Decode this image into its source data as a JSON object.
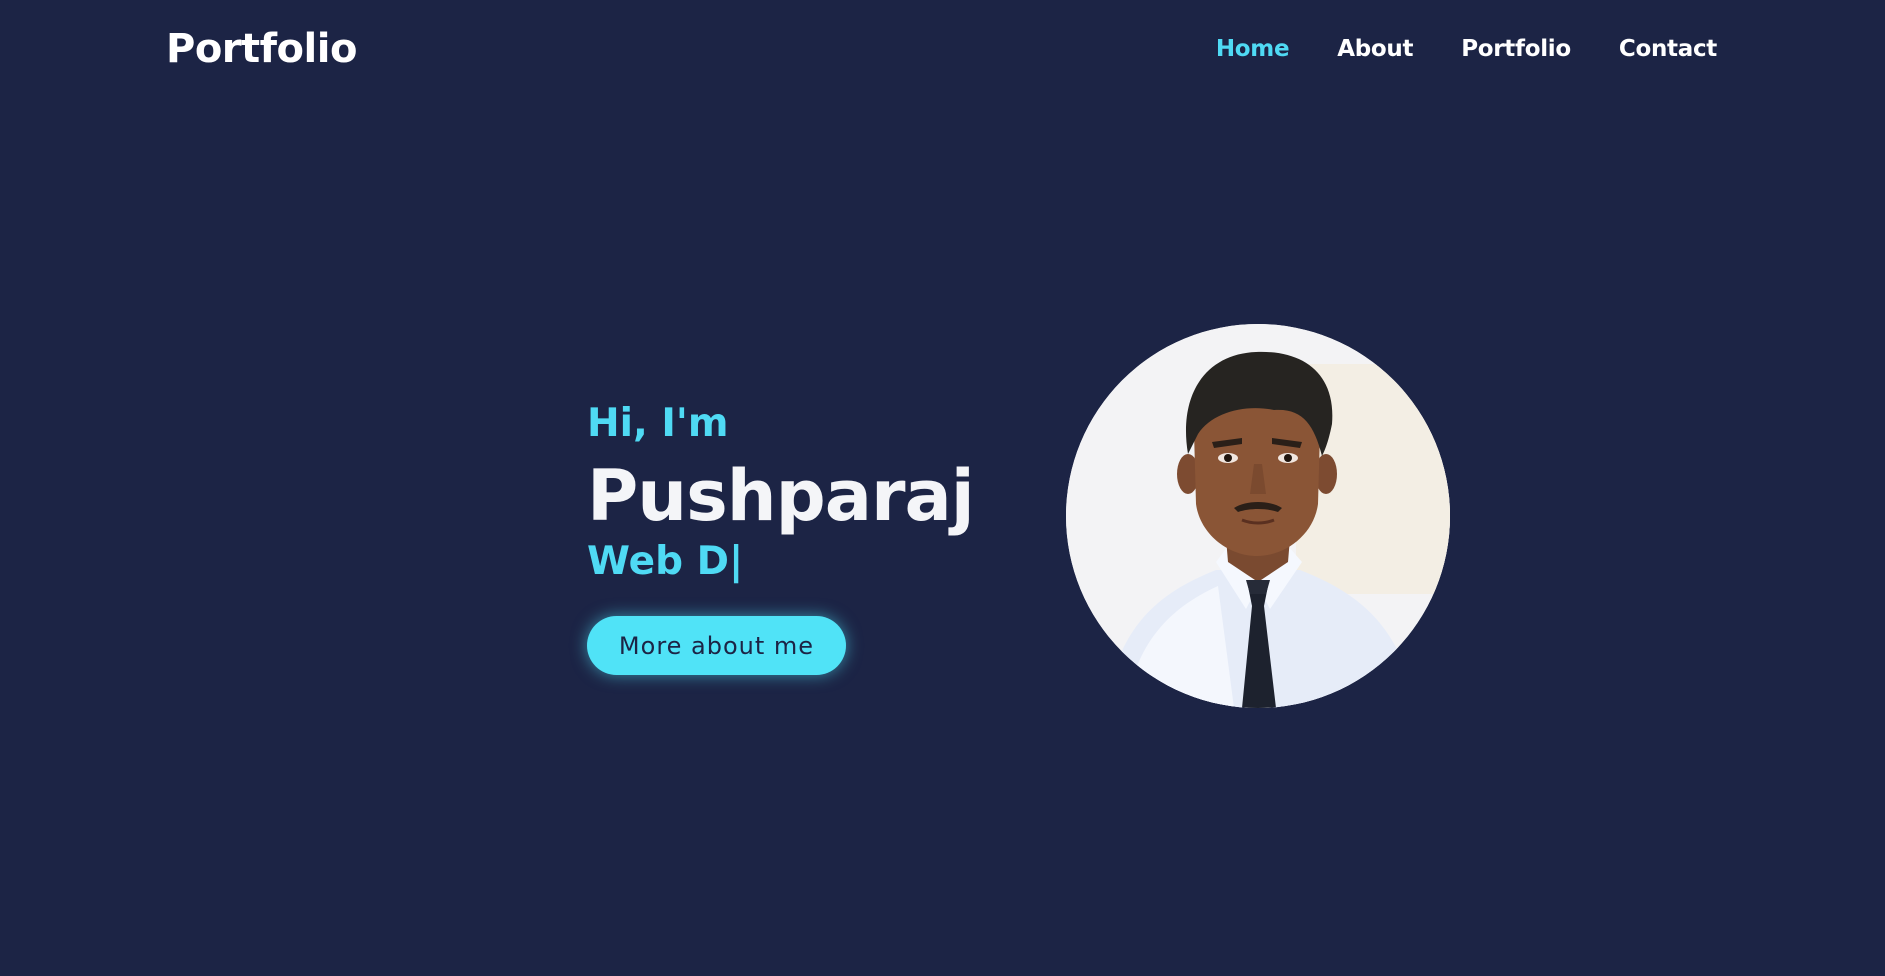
{
  "header": {
    "logo": "Portfolio",
    "nav": [
      {
        "label": "Home",
        "active": true
      },
      {
        "label": "About",
        "active": false
      },
      {
        "label": "Portfolio",
        "active": false
      },
      {
        "label": "Contact",
        "active": false
      }
    ]
  },
  "hero": {
    "greeting": "Hi, I'm",
    "name": "Pushparaj",
    "role": "Web D|",
    "cta_label": "More about me"
  },
  "colors": {
    "background": "#1c2445",
    "accent": "#4fdaf4",
    "text": "#ffffff"
  }
}
